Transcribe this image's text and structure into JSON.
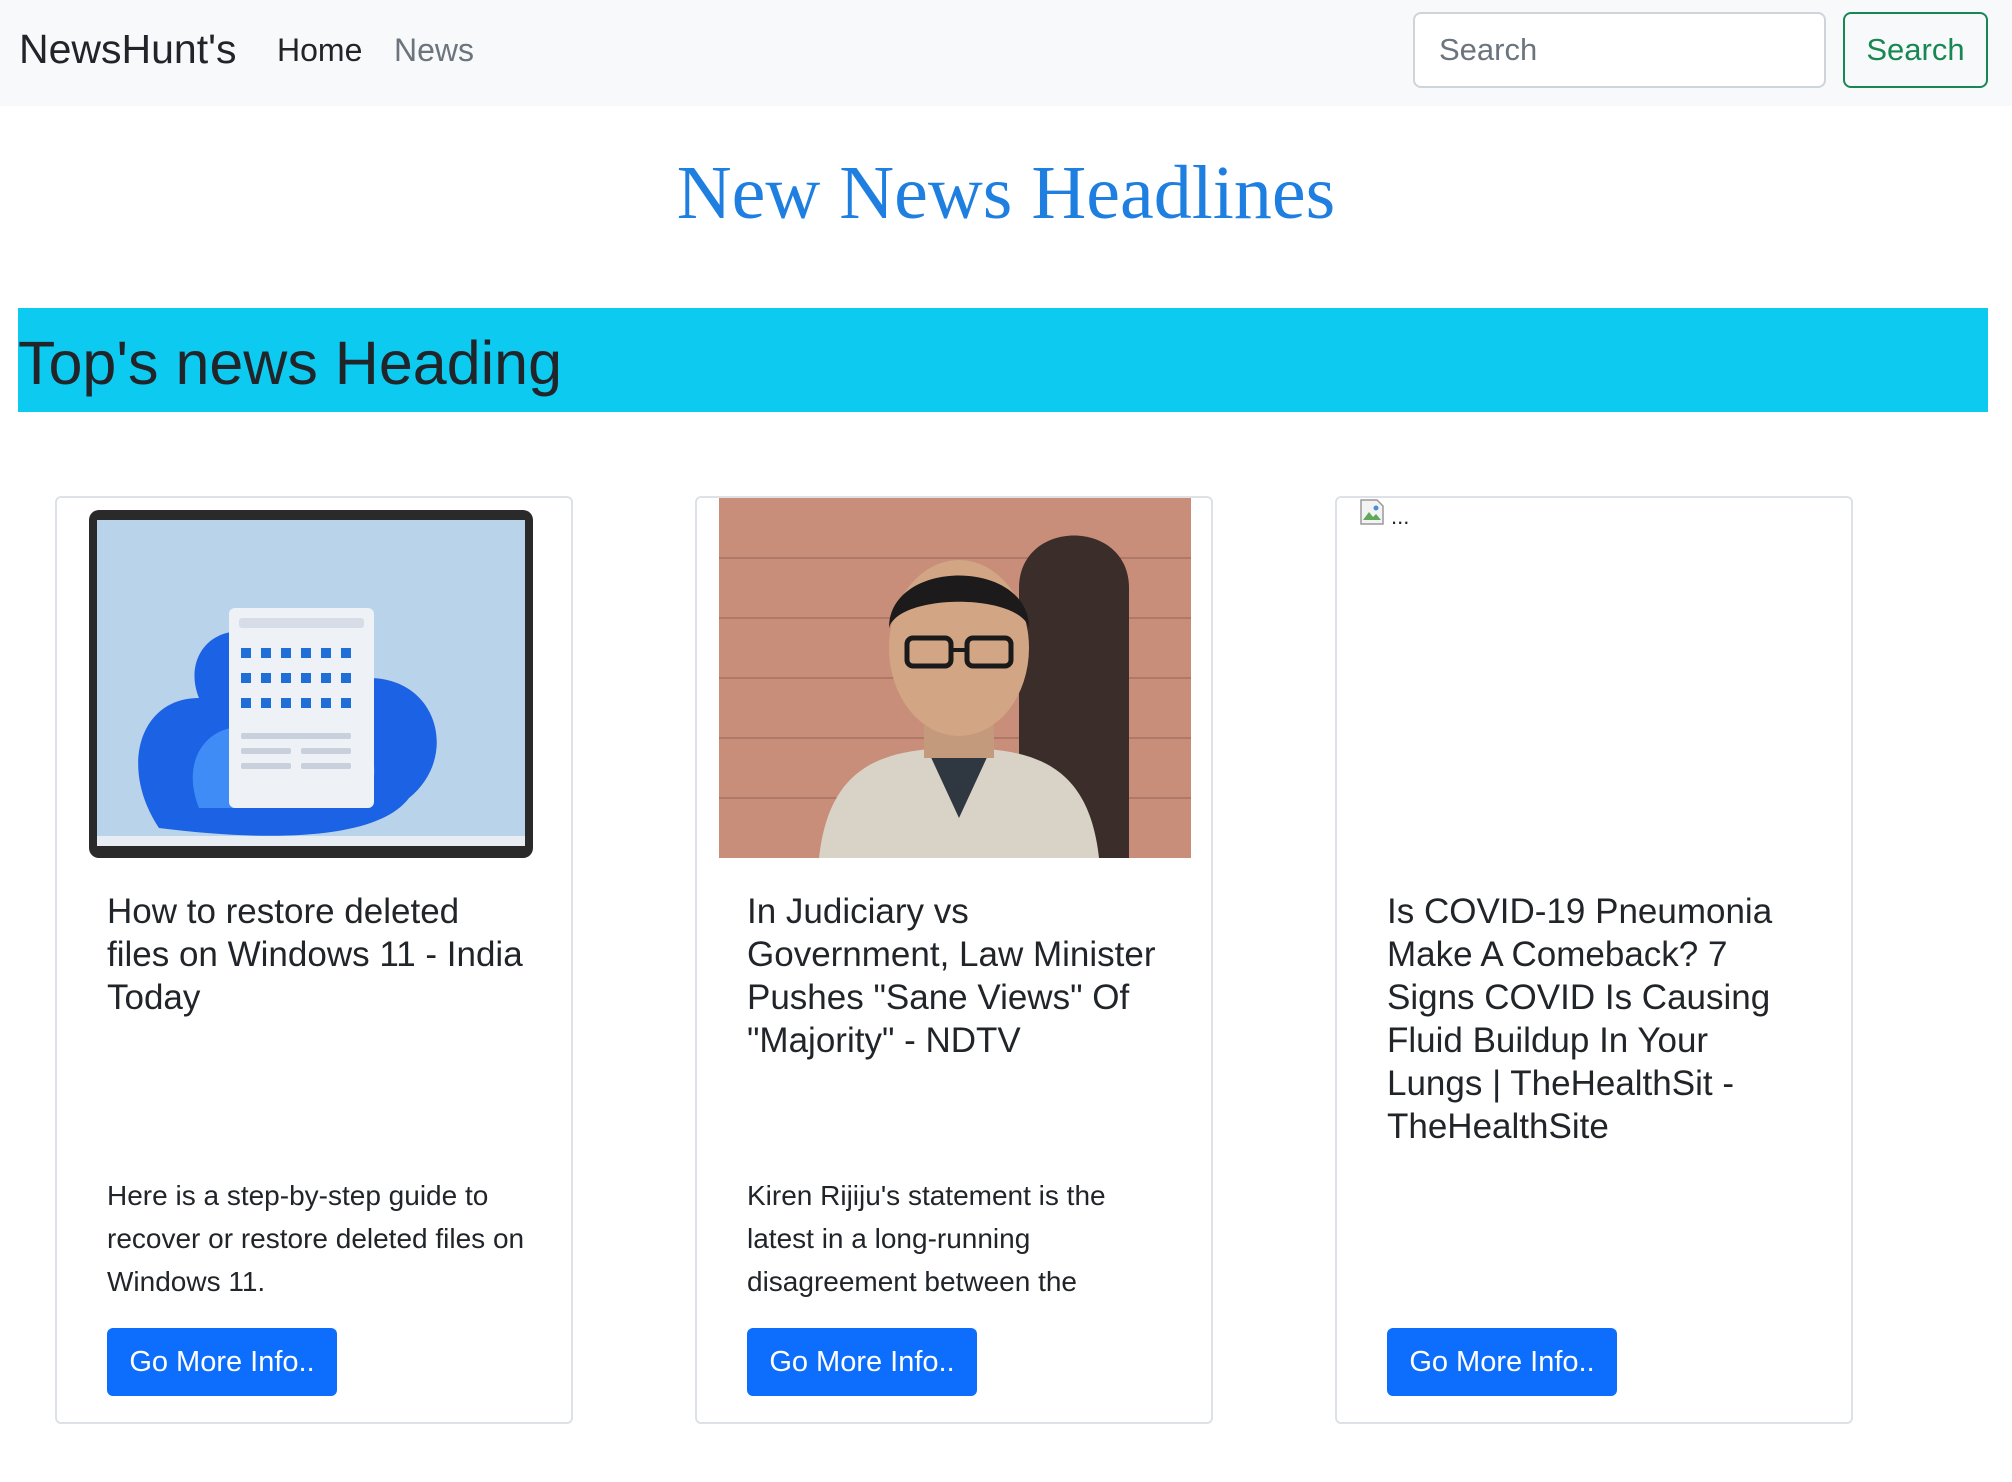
{
  "navbar": {
    "brand": "NewsHunt's",
    "links": [
      {
        "label": "Home"
      },
      {
        "label": "News"
      }
    ],
    "search_placeholder": "Search",
    "search_button": "Search"
  },
  "main_title": "New News Headlines",
  "banner_title": "Top's news Heading",
  "cards": [
    {
      "title": "How to restore deleted files on Windows 11 - India Today",
      "text": "Here is a step-by-step guide to recover or restore deleted files on Windows 11.",
      "button": "Go More Info.."
    },
    {
      "title": "In Judiciary vs Government, Law Minister Pushes \"Sane Views\" Of \"Majority\" - NDTV",
      "text": "Kiren Rijiju's statement is the latest in a long-running disagreement between the",
      "button": "Go More Info.."
    },
    {
      "title": "Is COVID-19 Pneumonia Make A Comeback? 7 Signs COVID Is Causing Fluid Buildup In Your Lungs | TheHealthSit - TheHealthSite",
      "text": "",
      "image_alt": "...",
      "button": "Go More Info.."
    }
  ],
  "colors": {
    "accent_title": "#1e7fe0",
    "banner": "#0dcaf0",
    "primary_button": "#0d6efd",
    "success_outline": "#198754",
    "navbar_bg": "#f8f9fa"
  }
}
